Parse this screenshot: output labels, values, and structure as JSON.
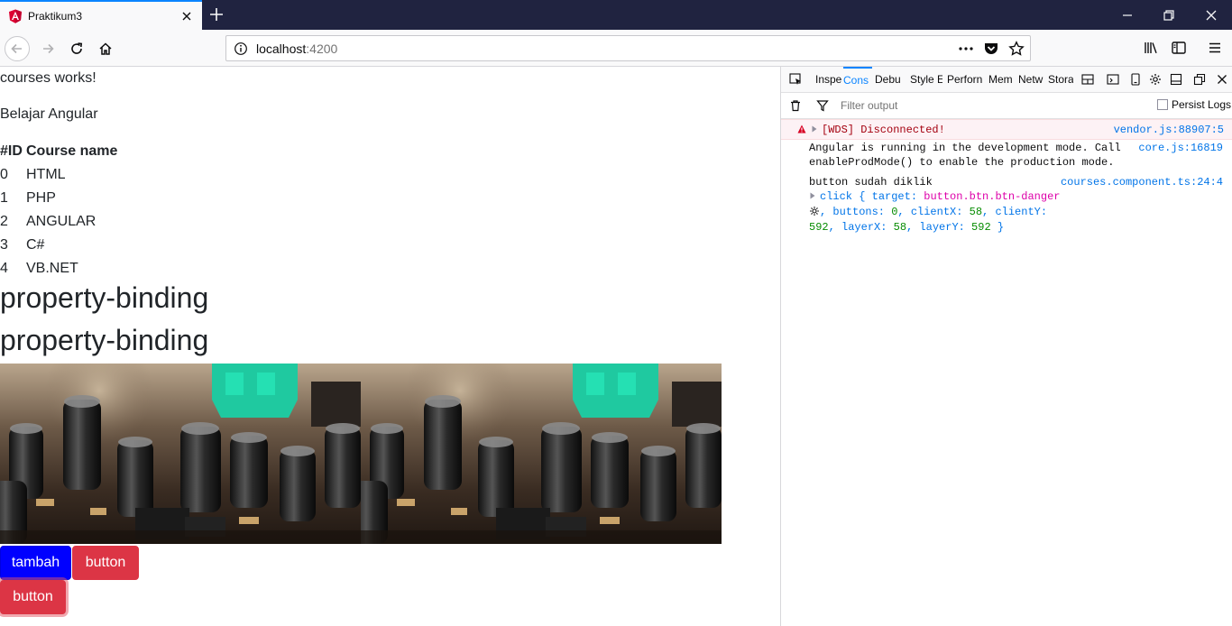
{
  "browser": {
    "tab_title": "Praktikum3",
    "url_host": "localhost",
    "url_port": ":4200"
  },
  "page": {
    "heading1": "courses works!",
    "heading2": "Belajar Angular",
    "table": {
      "headers": [
        "#ID",
        "Course name"
      ],
      "rows": [
        {
          "id": "0",
          "name": "HTML"
        },
        {
          "id": "1",
          "name": "PHP"
        },
        {
          "id": "2",
          "name": "ANGULAR"
        },
        {
          "id": "3",
          "name": "C#"
        },
        {
          "id": "4",
          "name": "VB.NET"
        }
      ]
    },
    "binding1": "property-binding",
    "binding2": "property-binding",
    "buttons": {
      "tambah": "tambah",
      "button1": "button",
      "button2": "button"
    }
  },
  "devtools": {
    "tabs": [
      "Inspe",
      "Cons",
      "Debu",
      "Style E",
      "Perforn",
      "Mem",
      "Netw",
      "Stora"
    ],
    "filter_placeholder": "Filter output",
    "persist_logs": "Persist Logs",
    "messages": {
      "error_text": "[WDS] Disconnected!",
      "error_loc": "vendor.js:88907:5",
      "info_line1": "Angular is running in the development mode. Call",
      "info_line2": "enableProdMode() to enable the production mode.",
      "info_loc": "core.js:16819",
      "log_text": "button sudah diklik",
      "log_loc": "courses.component.ts:24:4",
      "obj_click": "click",
      "obj_brace_open": "{",
      "obj_target_key": "target:",
      "obj_target_val": "button.btn.btn-danger",
      "obj_buttons_key": ", buttons:",
      "obj_buttons_val": "0",
      "obj_clientx_key": ", clientX:",
      "obj_clientx_val": "58",
      "obj_clienty_key": ", clientY:",
      "obj_clienty_val": "592",
      "obj_layerx_key": ", layerX:",
      "obj_layerx_val": "58",
      "obj_layery_key": ", layerY:",
      "obj_layery_val": "592",
      "obj_brace_close": "}"
    }
  },
  "colors": {
    "titlebar": "#202340",
    "accent": "#0a84ff",
    "btn_primary": "#0000ff",
    "btn_danger": "#dc3545"
  }
}
